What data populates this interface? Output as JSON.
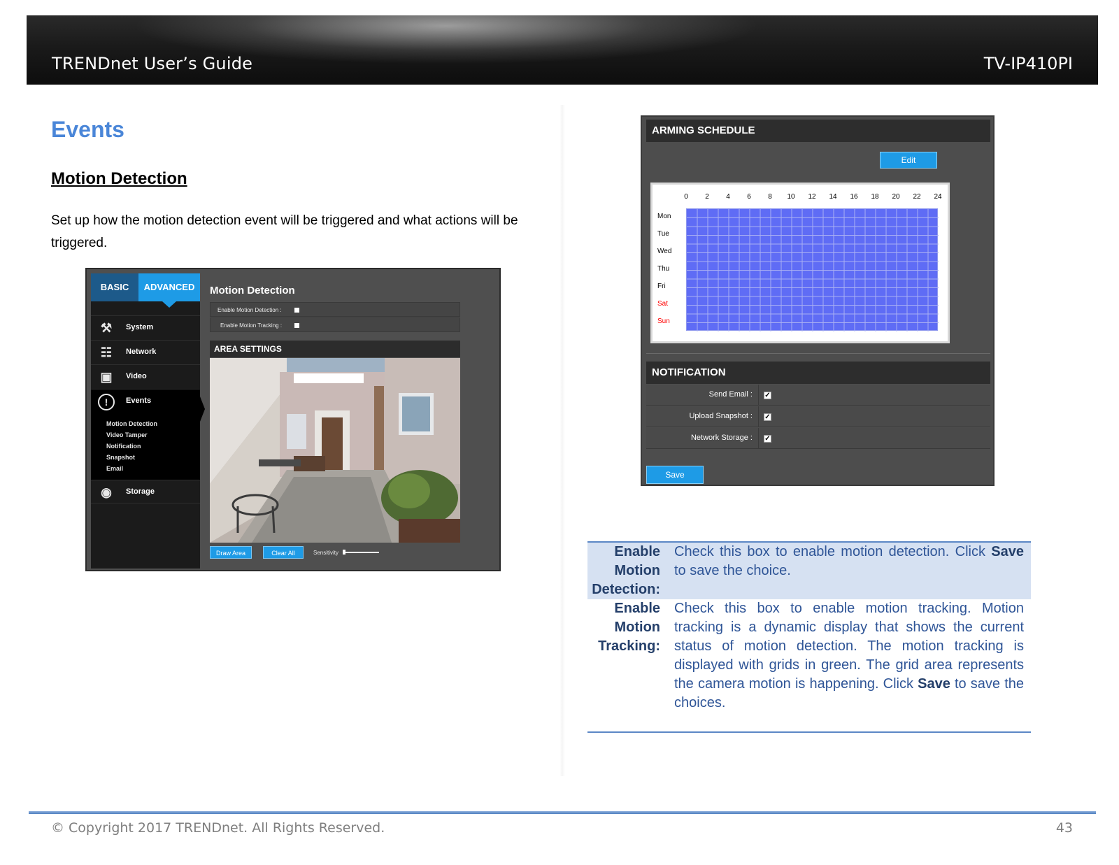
{
  "header": {
    "guide_title": "TRENDnet User’s Guide",
    "model": "TV-IP410PI"
  },
  "footer": {
    "copyright": "© Copyright 2017 TRENDnet. All Rights Reserved.",
    "page_number": "43"
  },
  "section": {
    "title": "Events",
    "subtitle": "Motion Detection",
    "intro": "Set up how the motion detection event will be triggered and what actions will be triggered."
  },
  "camera_ui": {
    "tabs": [
      "BASIC",
      "ADVANCED"
    ],
    "menu": [
      {
        "label": "System",
        "icon": "system-tools-icon"
      },
      {
        "label": "Network",
        "icon": "network-icon"
      },
      {
        "label": "Video",
        "icon": "video-camera-icon"
      },
      {
        "label": "Events",
        "icon": "exclamation-icon"
      },
      {
        "label": "Storage",
        "icon": "storage-disk-icon"
      }
    ],
    "submenu": [
      "Motion Detection",
      "Video Tamper",
      "Notification",
      "Snapshot",
      "Email"
    ],
    "title": "Motion Detection",
    "enable_motion_detection": "Enable Motion Detection :",
    "enable_motion_tracking": "Enable Motion Tracking :",
    "area_settings": "AREA SETTINGS",
    "draw_area": "Draw Area",
    "clear_all": "Clear All",
    "sensitivity": "Sensitivity"
  },
  "arming": {
    "title": "ARMING SCHEDULE",
    "edit": "Edit",
    "hours": [
      "0",
      "2",
      "4",
      "6",
      "8",
      "10",
      "12",
      "14",
      "16",
      "18",
      "20",
      "22",
      "24"
    ],
    "days": [
      "Mon",
      "Tue",
      "Wed",
      "Thu",
      "Fri",
      "Sat",
      "Sun"
    ],
    "weekend_color": "#ff0000",
    "schedule_color": "#5f6cf5"
  },
  "notification": {
    "title": "NOTIFICATION",
    "rows": [
      {
        "label": "Send Email :",
        "checked": true
      },
      {
        "label": "Upload Snapshot :",
        "checked": true
      },
      {
        "label": "Network Storage :",
        "checked": true
      }
    ],
    "save": "Save"
  },
  "table": {
    "rows": [
      {
        "term_lines": [
          "Enable",
          "Motion",
          "Detection:"
        ],
        "def_before": "Check this box to enable motion detection. Click ",
        "def_bold": "Save",
        "def_after": " to save the choice."
      },
      {
        "term_lines": [
          "Enable",
          "Motion",
          "Tracking:"
        ],
        "def_before": "Check this box to enable motion tracking. Motion tracking is a dynamic display that shows the current status of motion detection. The motion tracking is displayed with grids in green. The grid area represents the camera motion is happening. Click ",
        "def_bold": "Save",
        "def_after": " to save the choices."
      }
    ]
  },
  "colors": {
    "accent_blue": "#4a86d8",
    "ui_button_blue": "#1e9be6",
    "table_text": "#2f5597"
  }
}
